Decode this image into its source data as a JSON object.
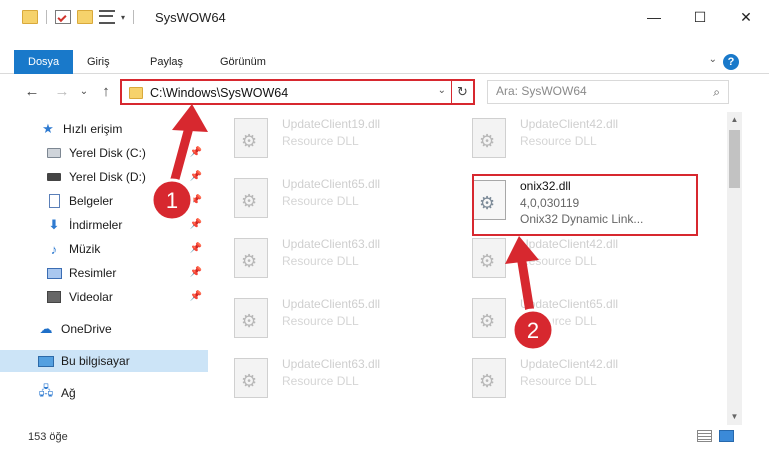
{
  "window": {
    "title": "SysWOW64",
    "controls": {
      "minimize": "—",
      "maximize": "☐",
      "close": "✕"
    }
  },
  "quick_access_toolbar": {
    "icons": [
      "folder-icon",
      "properties-icon",
      "new-folder-icon",
      "view-icon"
    ],
    "dropdown": "▾"
  },
  "ribbon": {
    "tabs": [
      "Dosya",
      "Giriş",
      "Paylaş",
      "Görünüm"
    ],
    "help": "?",
    "expand": "⌄"
  },
  "address_bar": {
    "path": "C:\\Windows\\SysWOW64",
    "back": "←",
    "forward": "→",
    "recent": "⌄",
    "up": "↑",
    "dropdown": "⌄",
    "refresh": "↻"
  },
  "search": {
    "placeholder": "Ara: SysWOW64",
    "icon": "⌕"
  },
  "nav_pane": {
    "items": [
      {
        "label": "Hızlı erişim",
        "icon": "star-icon",
        "pinned": false
      },
      {
        "label": "Yerel Disk (C:)",
        "icon": "drive-icon",
        "pinned": true
      },
      {
        "label": "Yerel Disk (D:)",
        "icon": "drive-icon",
        "pinned": true
      },
      {
        "label": "Belgeler",
        "icon": "documents-icon",
        "pinned": true
      },
      {
        "label": "İndirmeler",
        "icon": "downloads-icon",
        "pinned": true
      },
      {
        "label": "Müzik",
        "icon": "music-icon",
        "pinned": true
      },
      {
        "label": "Resimler",
        "icon": "pictures-icon",
        "pinned": true
      },
      {
        "label": "Videolar",
        "icon": "videos-icon",
        "pinned": true
      },
      {
        "label": "OneDrive",
        "icon": "onedrive-icon",
        "pinned": false
      },
      {
        "label": "Bu bilgisayar",
        "icon": "this-pc-icon",
        "pinned": false,
        "selected": true
      },
      {
        "label": "Ağ",
        "icon": "network-icon",
        "pinned": false
      }
    ],
    "pin_glyph": "📌"
  },
  "files": [
    {
      "name": "UpdateClient19.dll",
      "desc": "Resource DLL"
    },
    {
      "name": "UpdateClient42.dll",
      "desc": "Resource DLL"
    },
    {
      "name": "UpdateClient65.dll",
      "desc": "Resource DLL"
    },
    {
      "name": "onix32.dll",
      "version": "4,0,030119",
      "desc": "Onix32 Dynamic Link...",
      "highlight": true
    },
    {
      "name": "UpdateClient63.dll",
      "desc": "Resource DLL"
    },
    {
      "name": "UpdateClient42.dll",
      "desc": "Resource DLL"
    },
    {
      "name": "UpdateClient65.dll",
      "desc": "Resource DLL"
    },
    {
      "name": "UpdateClient65.dll",
      "desc": "Resource DLL"
    },
    {
      "name": "UpdateClient63.dll",
      "desc": "Resource DLL"
    },
    {
      "name": "UpdateClient42.dll",
      "desc": "Resource DLL"
    }
  ],
  "annotations": {
    "badge_1": "1",
    "badge_2": "2",
    "color": "#d7282f"
  },
  "status_bar": {
    "count": "153 öğe"
  },
  "colors": {
    "accent": "#1979ca",
    "selection": "#cce4f7",
    "annotation_red": "#d7282f"
  }
}
